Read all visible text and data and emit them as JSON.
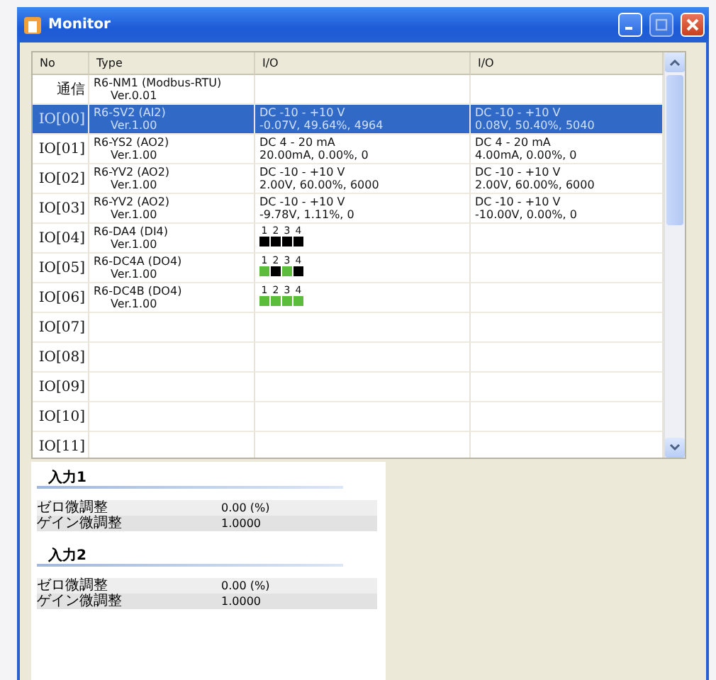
{
  "window": {
    "title": "Monitor"
  },
  "table": {
    "columns": [
      "No",
      "Type",
      "I/O",
      "I/O"
    ],
    "rows": [
      {
        "no": "通信",
        "type": "R6-NM1 (Modbus-RTU)",
        "version": "Ver.0.01",
        "selected": false,
        "io": []
      },
      {
        "no": "IO[00]",
        "type": "R6-SV2 (AI2)",
        "version": "Ver.1.00",
        "selected": true,
        "io": [
          {
            "kind": "text",
            "range": "DC -10 - +10 V",
            "reading": "-0.07V, 49.64%, 4964"
          },
          {
            "kind": "text",
            "range": "DC -10 - +10 V",
            "reading": "0.08V, 50.40%, 5040"
          }
        ]
      },
      {
        "no": "IO[01]",
        "type": "R6-YS2 (AO2)",
        "version": "Ver.1.00",
        "selected": false,
        "io": [
          {
            "kind": "text",
            "range": "DC 4 - 20 mA",
            "reading": "20.00mA, 0.00%, 0"
          },
          {
            "kind": "text",
            "range": "DC 4 - 20 mA",
            "reading": "4.00mA, 0.00%, 0"
          }
        ]
      },
      {
        "no": "IO[02]",
        "type": "R6-YV2 (AO2)",
        "version": "Ver.1.00",
        "selected": false,
        "io": [
          {
            "kind": "text",
            "range": "DC -10 - +10 V",
            "reading": "2.00V, 60.00%, 6000"
          },
          {
            "kind": "text",
            "range": "DC -10 - +10 V",
            "reading": "2.00V, 60.00%, 6000"
          }
        ]
      },
      {
        "no": "IO[03]",
        "type": "R6-YV2 (AO2)",
        "version": "Ver.1.00",
        "selected": false,
        "io": [
          {
            "kind": "text",
            "range": "DC -10 - +10 V",
            "reading": "-9.78V, 1.11%, 0"
          },
          {
            "kind": "text",
            "range": "DC -10 - +10 V",
            "reading": "-10.00V, 0.00%, 0"
          }
        ]
      },
      {
        "no": "IO[04]",
        "type": "R6-DA4 (DI4)",
        "version": "Ver.1.00",
        "selected": false,
        "io": [
          {
            "kind": "bits",
            "bits": [
              {
                "label": "1",
                "on": false
              },
              {
                "label": "2",
                "on": false
              },
              {
                "label": "3",
                "on": false
              },
              {
                "label": "4",
                "on": false
              }
            ]
          }
        ]
      },
      {
        "no": "IO[05]",
        "type": "R6-DC4A (DO4)",
        "version": "Ver.1.00",
        "selected": false,
        "io": [
          {
            "kind": "bits",
            "bits": [
              {
                "label": "1",
                "on": true
              },
              {
                "label": "2",
                "on": false
              },
              {
                "label": "3",
                "on": true
              },
              {
                "label": "4",
                "on": false
              }
            ]
          }
        ]
      },
      {
        "no": "IO[06]",
        "type": "R6-DC4B (DO4)",
        "version": "Ver.1.00",
        "selected": false,
        "io": [
          {
            "kind": "bits",
            "bits": [
              {
                "label": "1",
                "on": true
              },
              {
                "label": "2",
                "on": true
              },
              {
                "label": "3",
                "on": true
              },
              {
                "label": "4",
                "on": true
              }
            ]
          }
        ]
      },
      {
        "no": "IO[07]",
        "selected": false,
        "io": []
      },
      {
        "no": "IO[08]",
        "selected": false,
        "io": []
      },
      {
        "no": "IO[09]",
        "selected": false,
        "io": []
      },
      {
        "no": "IO[10]",
        "selected": false,
        "io": []
      },
      {
        "no": "IO[11]",
        "selected": false,
        "io": []
      }
    ]
  },
  "details": [
    {
      "title": "入力1",
      "rows": [
        {
          "label": "ゼロ微調整",
          "value": "0.00 (%)"
        },
        {
          "label": "ゲイン微調整",
          "value": "1.0000"
        }
      ]
    },
    {
      "title": "入力2",
      "rows": [
        {
          "label": "ゼロ微調整",
          "value": "0.00 (%)"
        },
        {
          "label": "ゲイン微調整",
          "value": "1.0000"
        }
      ]
    }
  ]
}
